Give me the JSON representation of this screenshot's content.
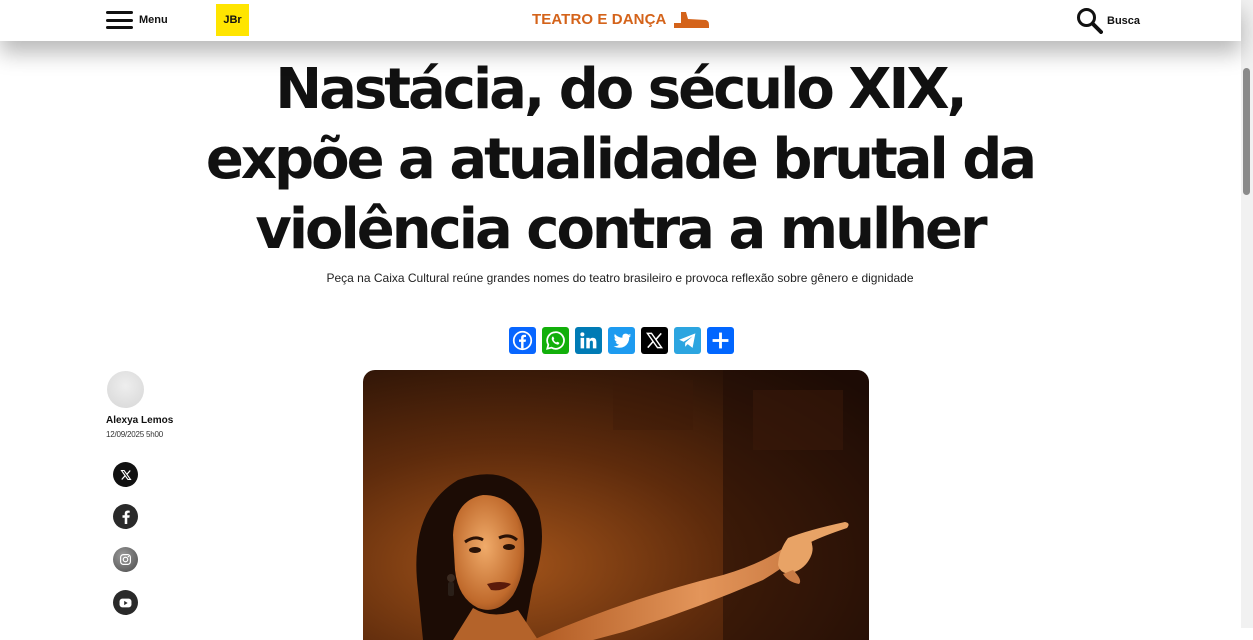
{
  "header": {
    "menu_label": "Menu",
    "logo_text": "JBr",
    "section_title": "TEATRO E DANÇA",
    "search_label": "Busca"
  },
  "article": {
    "headline": "Nastácia, do século XIX, expõe a atualidade brutal da violência contra a mulher",
    "subtitle": "Peça na Caixa Cultural reúne grandes nomes do teatro brasileiro e provoca reflexão sobre gênero e dignidade"
  },
  "share": {
    "buttons": [
      {
        "name": "facebook",
        "icon": "facebook-icon",
        "color": "#0866ff"
      },
      {
        "name": "whatsapp",
        "icon": "whatsapp-icon",
        "color": "#12af0a"
      },
      {
        "name": "linkedin",
        "icon": "linkedin-icon",
        "color": "#007bb5"
      },
      {
        "name": "twitter",
        "icon": "twitter-icon",
        "color": "#1d9bf0"
      },
      {
        "name": "x",
        "icon": "x-icon",
        "color": "#000000"
      },
      {
        "name": "telegram",
        "icon": "telegram-icon",
        "color": "#2ca5e0"
      },
      {
        "name": "share",
        "icon": "plus-icon",
        "color": "#0166ff"
      }
    ]
  },
  "author": {
    "name": "Alexya Lemos",
    "date": "12/09/2025 5h00"
  },
  "social_links": [
    "x-icon",
    "facebook-icon",
    "instagram-icon",
    "youtube-icon"
  ],
  "colors": {
    "section_accent": "#d4631a",
    "logo_yellow": "#ffe500"
  }
}
